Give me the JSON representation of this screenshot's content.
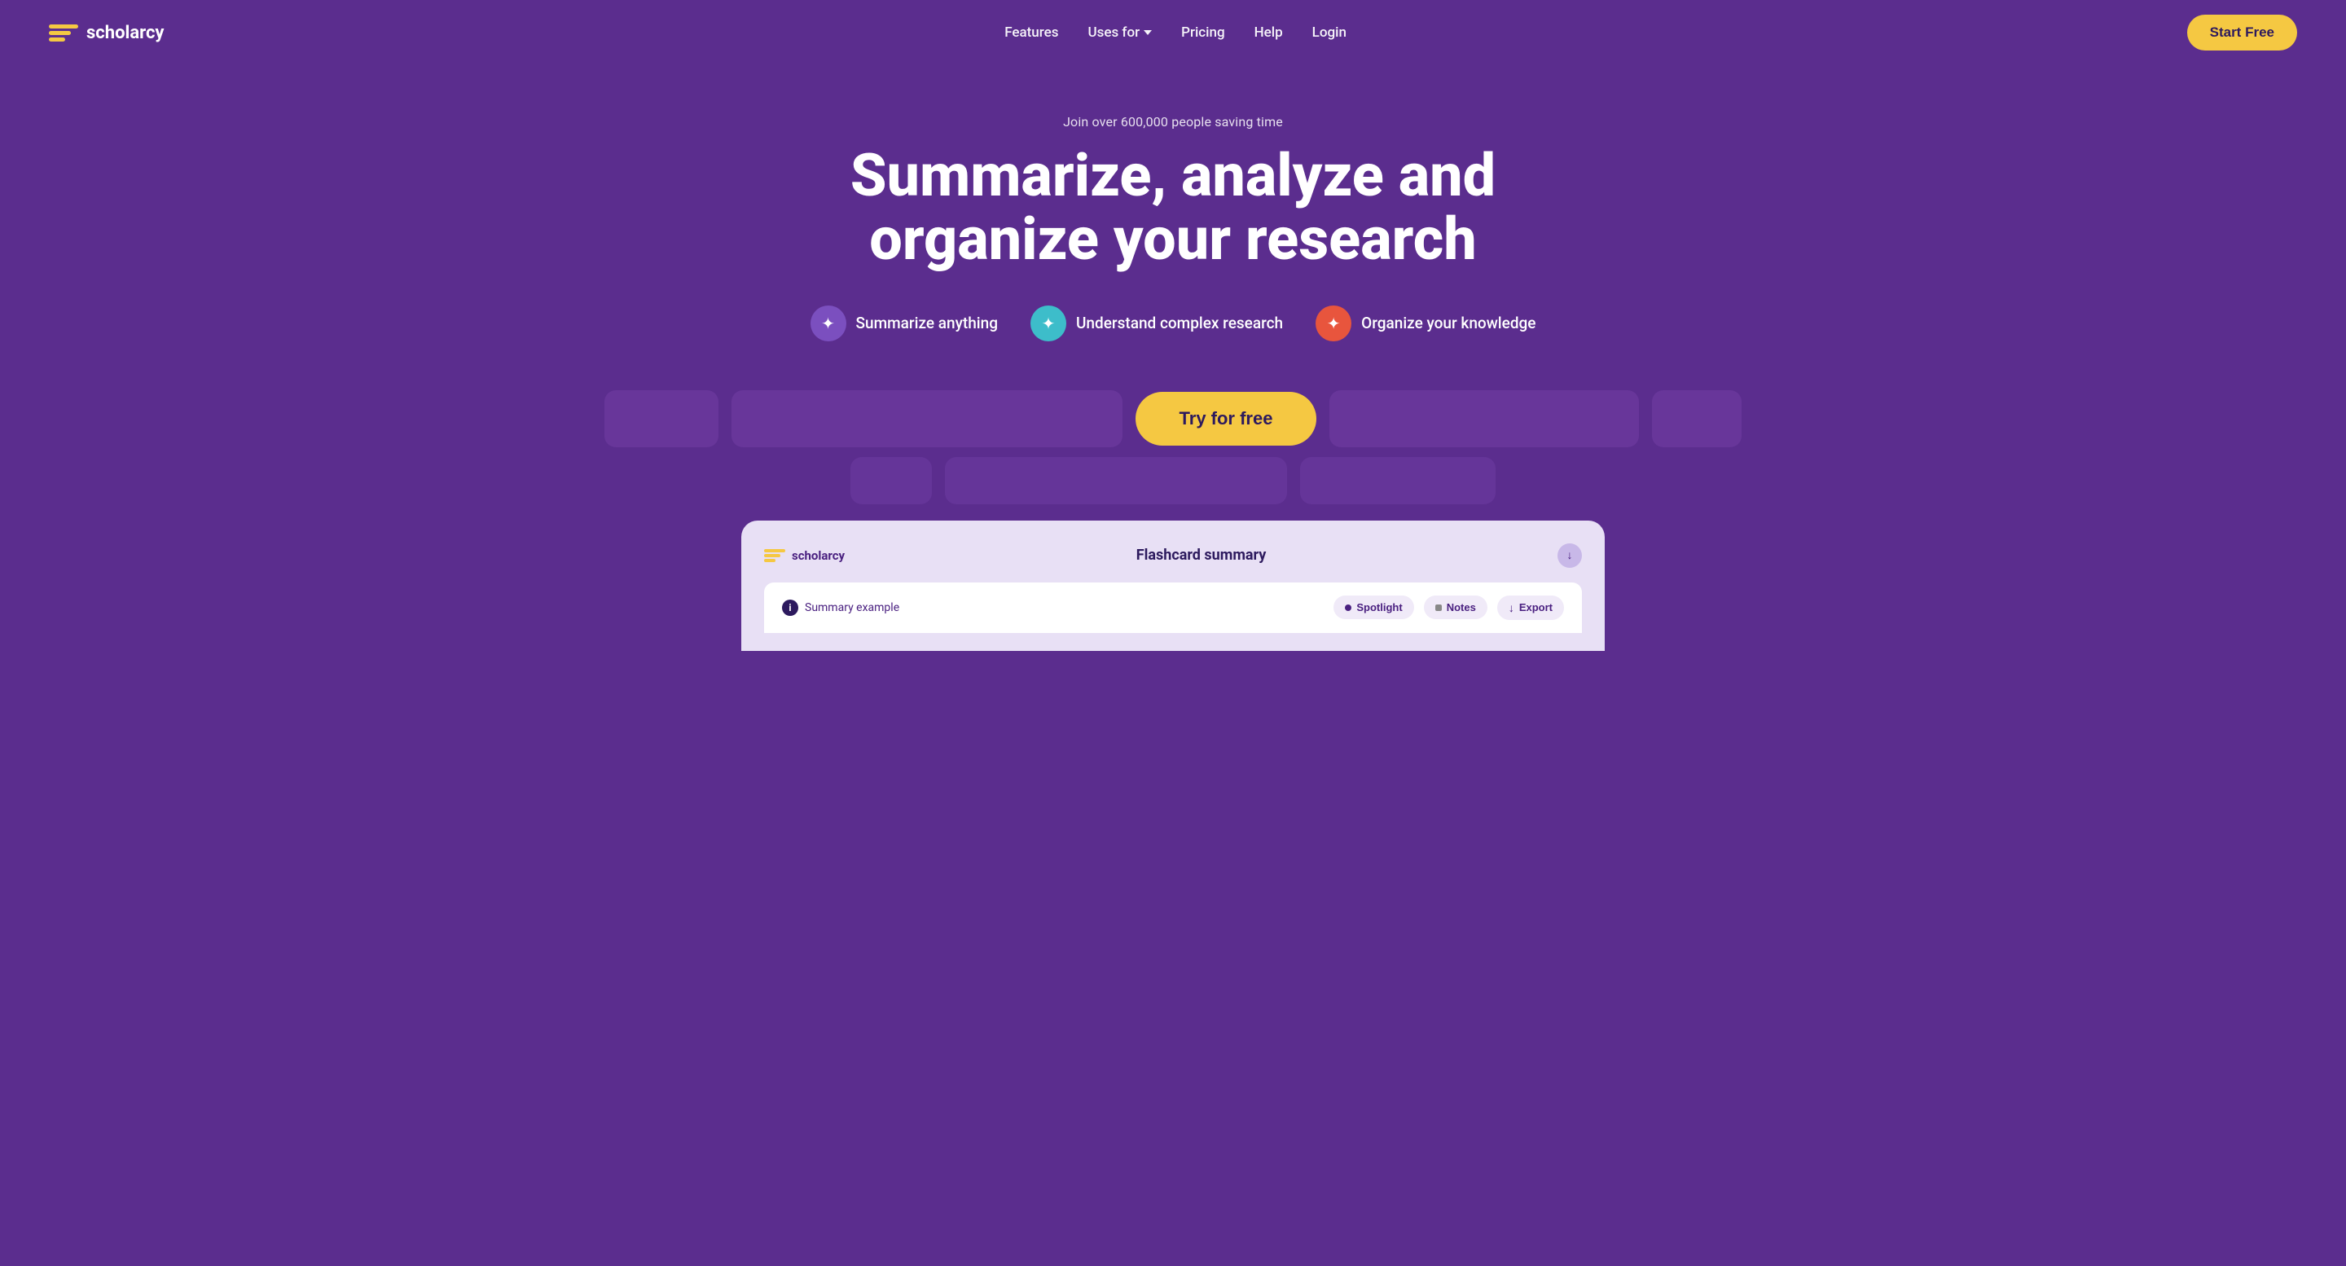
{
  "nav": {
    "logo_text": "scholarcy",
    "links": [
      {
        "label": "Features",
        "id": "features"
      },
      {
        "label": "Uses for",
        "id": "uses-for",
        "has_dropdown": true
      },
      {
        "label": "Pricing",
        "id": "pricing"
      },
      {
        "label": "Help",
        "id": "help"
      },
      {
        "label": "Login",
        "id": "login"
      }
    ],
    "cta_label": "Start Free"
  },
  "hero": {
    "sub_label": "Join over 600,000 people saving time",
    "title_line1": "Summarize, analyze and",
    "title_line2": "organize your research"
  },
  "features": [
    {
      "label": "Summarize anything",
      "icon": "✦",
      "color_class": "pill-icon-purple"
    },
    {
      "label": "Understand complex research",
      "icon": "✦",
      "color_class": "pill-icon-teal"
    },
    {
      "label": "Organize your knowledge",
      "icon": "✦",
      "color_class": "pill-icon-orange"
    }
  ],
  "cta": {
    "try_free_label": "Try for free"
  },
  "app_preview": {
    "logo_text": "scholarcy",
    "title": "Flashcard summary",
    "summary_label": "Summary example",
    "spotlight_label": "Spotlight",
    "notes_label": "Notes",
    "export_label": "Export"
  },
  "colors": {
    "bg": "#5b2d8e",
    "cta_bg": "#f5c842",
    "card_bg": "#e8e0f5"
  }
}
